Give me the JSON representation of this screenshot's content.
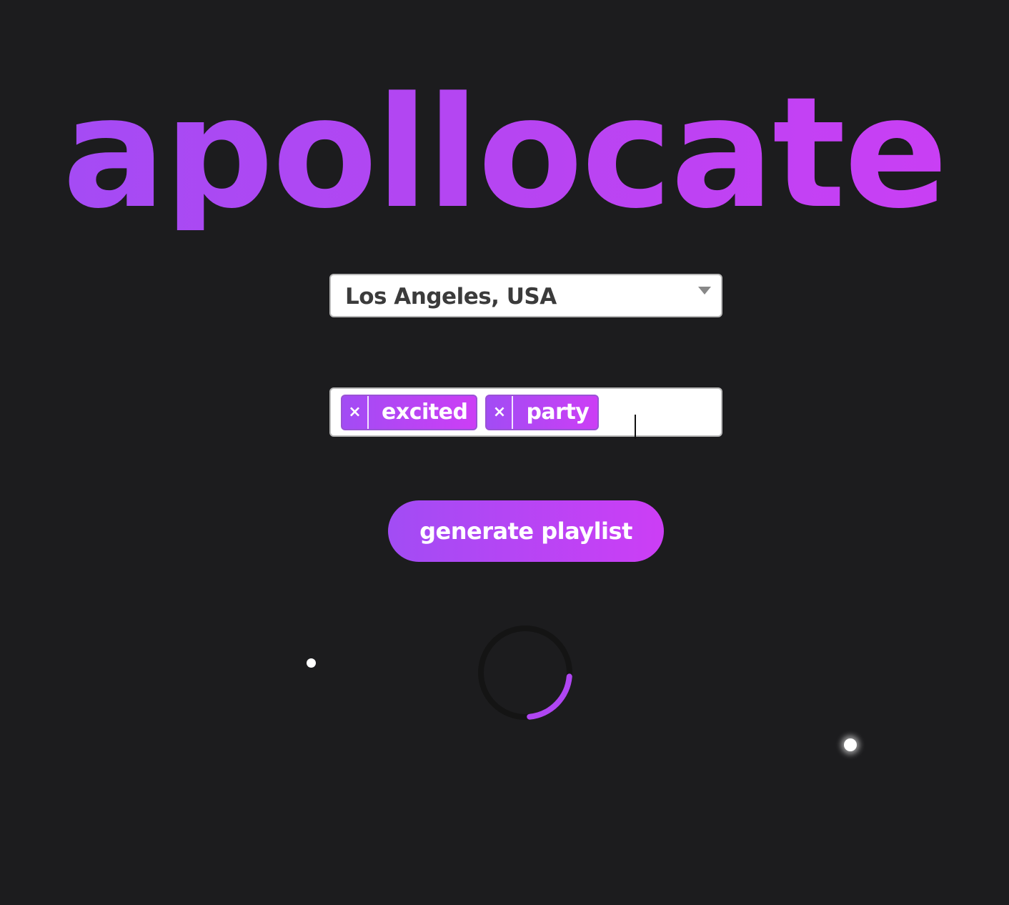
{
  "app": {
    "logo_text": "apollocate"
  },
  "location": {
    "selected": "Los Angeles, USA"
  },
  "moods": {
    "tags": [
      {
        "label": "excited",
        "remove_label": "×"
      },
      {
        "label": "party",
        "remove_label": "×"
      }
    ]
  },
  "actions": {
    "generate_label": "generate playlist"
  },
  "loading": {
    "progress": 0.22
  },
  "colors": {
    "background": "#1c1c1e",
    "accent_start": "#a24cf4",
    "accent_end": "#cc3ef5",
    "spinner_track": "#141414"
  }
}
